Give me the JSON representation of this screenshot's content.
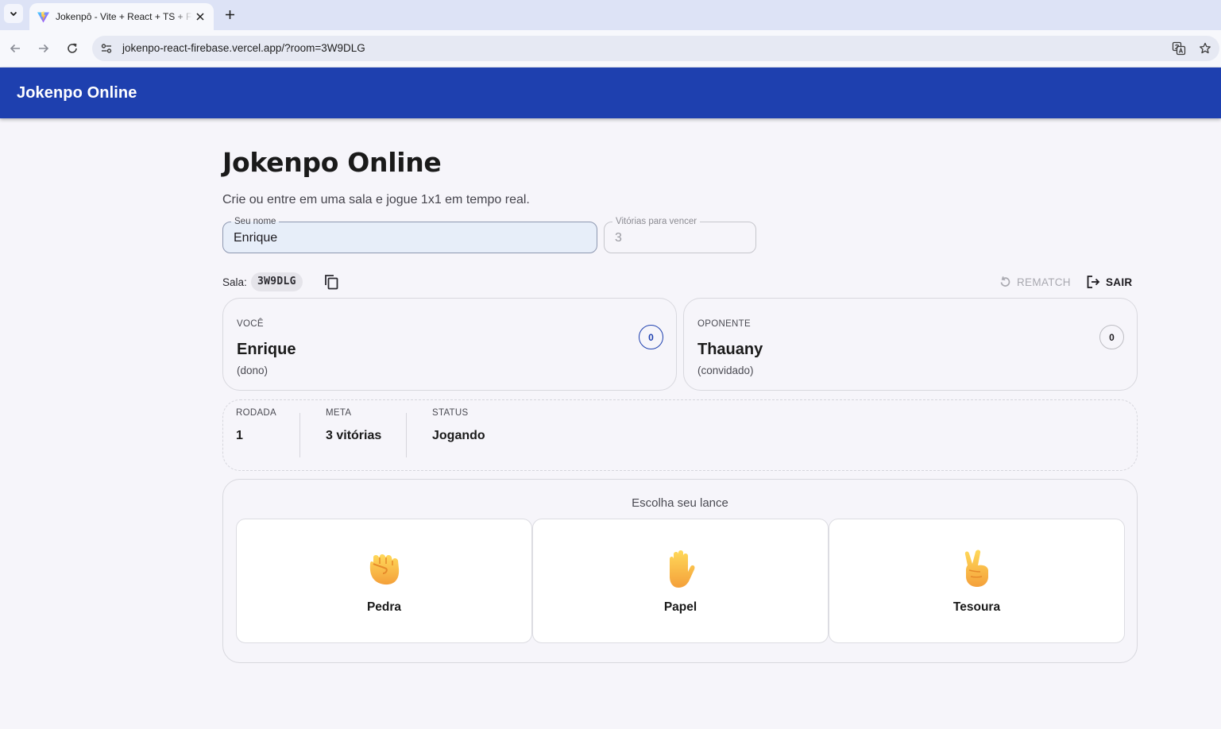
{
  "browser": {
    "tab_title": "Jokenpô - Vite + React + TS + Firebase",
    "url": "jokenpo-react-firebase.vercel.app/?room=3W9DLG"
  },
  "appbar": {
    "title": "Jokenpo Online"
  },
  "page": {
    "title": "Jokenpo Online",
    "subtitle": "Crie ou entre em uma sala e jogue 1x1 em tempo real."
  },
  "form": {
    "name_label": "Seu nome",
    "name_value": "Enrique",
    "wins_label": "Vitórias para vencer",
    "wins_value": "3"
  },
  "room": {
    "label": "Sala:",
    "code": "3W9DLG",
    "rematch_label": "REMATCH",
    "leave_label": "SAIR"
  },
  "players": {
    "you": {
      "role": "VOCÊ",
      "name": "Enrique",
      "sub": "(dono)",
      "score": "0"
    },
    "opponent": {
      "role": "OPONENTE",
      "name": "Thauany",
      "sub": "(convidado)",
      "score": "0"
    }
  },
  "round": {
    "round_label": "RODADA",
    "round_value": "1",
    "goal_label": "META",
    "goal_value": "3 vitórias",
    "status_label": "STATUS",
    "status_value": "Jogando"
  },
  "moves": {
    "prompt": "Escolha seu lance",
    "items": [
      {
        "label": "Pedra",
        "icon": "raised-fist-icon"
      },
      {
        "label": "Papel",
        "icon": "raised-hand-icon"
      },
      {
        "label": "Tesoura",
        "icon": "victory-hand-icon"
      }
    ]
  },
  "colors": {
    "primary": "#1e40af",
    "background": "#f6f5fa",
    "emoji_skin": "#f9c33a"
  }
}
